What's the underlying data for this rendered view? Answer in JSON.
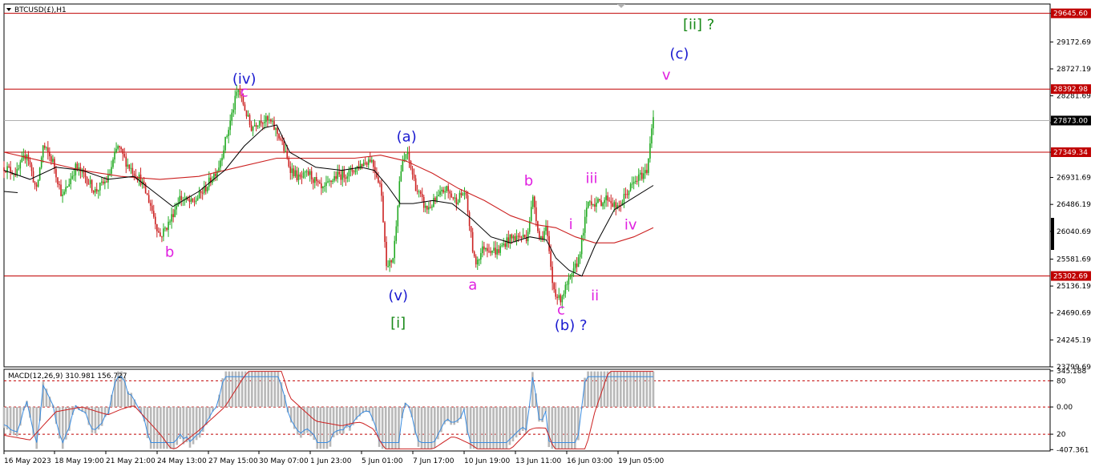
{
  "symbol_label": "BTCUSD(£),H1",
  "macd_label": "MACD(12,26,9) 310.981 156.727",
  "colors": {
    "bull": "#22aa22",
    "bear": "#cc2222",
    "ma_fast": "#000000",
    "ma_slow": "#cc2020",
    "level": "#c00000",
    "blue": "#1a1ad0",
    "magenta": "#e020e0",
    "green": "#1a8a1a",
    "macd_hist": "#b8b8b8",
    "macd_line": "#3a8ce0",
    "signal_line": "#cc2020"
  },
  "chart_data": {
    "type": "candlestick",
    "price_axis": {
      "min": 23799.69,
      "max": 29800,
      "ticks": [
        "29645.60",
        "29172.69",
        "28727.19",
        "28281.69",
        "27836.19",
        "27349.34",
        "26931.69",
        "26486.19",
        "26040.69",
        "25581.69",
        "25136.19",
        "24690.69",
        "24245.19",
        "23799.69"
      ]
    },
    "levels": [
      {
        "price": 29645.6,
        "label": "29645.60"
      },
      {
        "price": 28392.98,
        "label": "28392.98"
      },
      {
        "price": 27349.34,
        "label": "27349.34"
      },
      {
        "price": 25302.69,
        "label": "25302.69"
      }
    ],
    "current_price": {
      "price": 27873.0,
      "label": "27873.00"
    },
    "time_ticks": [
      "16 May 2023",
      "18 May 19:00",
      "21 May 21:00",
      "24 May 13:00",
      "27 May 15:00",
      "30 May 07:00",
      "1 Jun 23:00",
      "5 Jun 01:00",
      "7 Jun 17:00",
      "10 Jun 19:00",
      "13 Jun 11:00",
      "16 Jun 03:00",
      "19 Jun 05:00"
    ],
    "price_path": [
      [
        0,
        27100
      ],
      [
        0.02,
        27000
      ],
      [
        0.035,
        27350
      ],
      [
        0.05,
        26700
      ],
      [
        0.06,
        27450
      ],
      [
        0.075,
        27200
      ],
      [
        0.09,
        26600
      ],
      [
        0.11,
        27100
      ],
      [
        0.125,
        26950
      ],
      [
        0.14,
        26700
      ],
      [
        0.16,
        26900
      ],
      [
        0.175,
        27450
      ],
      [
        0.19,
        27150
      ],
      [
        0.21,
        26900
      ],
      [
        0.225,
        26500
      ],
      [
        0.24,
        25950
      ],
      [
        0.255,
        26200
      ],
      [
        0.27,
        26600
      ],
      [
        0.29,
        26500
      ],
      [
        0.31,
        26750
      ],
      [
        0.33,
        27100
      ],
      [
        0.345,
        27700
      ],
      [
        0.36,
        28400
      ],
      [
        0.37,
        28100
      ],
      [
        0.38,
        27750
      ],
      [
        0.395,
        27900
      ],
      [
        0.41,
        27850
      ],
      [
        0.425,
        27600
      ],
      [
        0.44,
        27100
      ],
      [
        0.455,
        26900
      ],
      [
        0.47,
        27000
      ],
      [
        0.49,
        26700
      ],
      [
        0.51,
        26950
      ],
      [
        0.53,
        27000
      ],
      [
        0.55,
        27150
      ],
      [
        0.565,
        27250
      ],
      [
        0.58,
        26800
      ],
      [
        0.59,
        25400
      ],
      [
        0.6,
        25650
      ],
      [
        0.61,
        27000
      ],
      [
        0.62,
        27350
      ],
      [
        0.635,
        26750
      ],
      [
        0.65,
        26400
      ],
      [
        0.665,
        26550
      ],
      [
        0.68,
        26750
      ],
      [
        0.695,
        26550
      ],
      [
        0.71,
        26700
      ],
      [
        0.725,
        25500
      ],
      [
        0.74,
        25800
      ],
      [
        0.76,
        25700
      ],
      [
        0.775,
        25900
      ],
      [
        0.79,
        25950
      ],
      [
        0.805,
        25950
      ],
      [
        0.815,
        26600
      ],
      [
        0.825,
        25900
      ],
      [
        0.835,
        26100
      ],
      [
        0.845,
        25150
      ],
      [
        0.855,
        24900
      ],
      [
        0.865,
        25100
      ],
      [
        0.875,
        25300
      ],
      [
        0.885,
        25600
      ],
      [
        0.9,
        26550
      ],
      [
        0.915,
        26500
      ],
      [
        0.93,
        26600
      ],
      [
        0.945,
        26400
      ],
      [
        0.96,
        26700
      ],
      [
        0.975,
        26900
      ],
      [
        0.99,
        27050
      ],
      [
        1,
        28000
      ]
    ],
    "ma_fast_path": [
      [
        0,
        27050
      ],
      [
        0.04,
        26900
      ],
      [
        0.08,
        27100
      ],
      [
        0.12,
        27050
      ],
      [
        0.16,
        26900
      ],
      [
        0.2,
        26950
      ],
      [
        0.23,
        26700
      ],
      [
        0.26,
        26450
      ],
      [
        0.3,
        26700
      ],
      [
        0.34,
        27050
      ],
      [
        0.37,
        27450
      ],
      [
        0.4,
        27750
      ],
      [
        0.42,
        27800
      ],
      [
        0.44,
        27350
      ],
      [
        0.48,
        27100
      ],
      [
        0.52,
        27050
      ],
      [
        0.55,
        27100
      ],
      [
        0.57,
        27050
      ],
      [
        0.59,
        26800
      ],
      [
        0.61,
        26500
      ],
      [
        0.63,
        26500
      ],
      [
        0.66,
        26550
      ],
      [
        0.69,
        26500
      ],
      [
        0.72,
        26250
      ],
      [
        0.75,
        25950
      ],
      [
        0.78,
        25850
      ],
      [
        0.81,
        25950
      ],
      [
        0.835,
        25900
      ],
      [
        0.85,
        25600
      ],
      [
        0.87,
        25400
      ],
      [
        0.89,
        25300
      ],
      [
        0.91,
        25800
      ],
      [
        0.94,
        26400
      ],
      [
        0.97,
        26600
      ],
      [
        1,
        26800
      ]
    ],
    "ma_slow_path": [
      [
        0,
        27350
      ],
      [
        0.06,
        27200
      ],
      [
        0.12,
        27050
      ],
      [
        0.18,
        26950
      ],
      [
        0.24,
        26900
      ],
      [
        0.3,
        26950
      ],
      [
        0.36,
        27100
      ],
      [
        0.42,
        27250
      ],
      [
        0.48,
        27250
      ],
      [
        0.54,
        27250
      ],
      [
        0.58,
        27300
      ],
      [
        0.62,
        27200
      ],
      [
        0.66,
        27000
      ],
      [
        0.7,
        26750
      ],
      [
        0.74,
        26550
      ],
      [
        0.78,
        26300
      ],
      [
        0.82,
        26150
      ],
      [
        0.85,
        26100
      ],
      [
        0.88,
        25950
      ],
      [
        0.91,
        25850
      ],
      [
        0.94,
        25850
      ],
      [
        0.97,
        25950
      ],
      [
        1,
        26100
      ]
    ],
    "macd": {
      "axis_ticks": [
        "345.188",
        "80",
        "0.00",
        "20",
        "-407.361"
      ],
      "levels": [
        80,
        0,
        -20
      ]
    },
    "annotations": [
      {
        "text": "(iv)",
        "x": 0.37,
        "price": 28480,
        "color": "blue"
      },
      {
        "text": "c",
        "x": 0.37,
        "price": 28270,
        "color": "magenta"
      },
      {
        "text": "b",
        "x": 0.255,
        "price": 25620,
        "color": "magenta"
      },
      {
        "text": "(a)",
        "x": 0.62,
        "price": 27530,
        "color": "blue"
      },
      {
        "text": "(v)",
        "x": 0.607,
        "price": 24900,
        "color": "blue"
      },
      {
        "text": "[i]",
        "x": 0.607,
        "price": 24450,
        "color": "green"
      },
      {
        "text": "b",
        "x": 0.808,
        "price": 26800,
        "color": "magenta"
      },
      {
        "text": "a",
        "x": 0.722,
        "price": 25080,
        "color": "magenta"
      },
      {
        "text": "c",
        "x": 0.858,
        "price": 24670,
        "color": "magenta"
      },
      {
        "text": "(b) ?",
        "x": 0.873,
        "price": 24410,
        "color": "blue"
      },
      {
        "text": "i",
        "x": 0.873,
        "price": 26080,
        "color": "magenta"
      },
      {
        "text": "ii",
        "x": 0.91,
        "price": 24900,
        "color": "magenta"
      },
      {
        "text": "iii",
        "x": 0.905,
        "price": 26840,
        "color": "magenta"
      },
      {
        "text": "iv",
        "x": 0.965,
        "price": 26070,
        "color": "magenta"
      },
      {
        "text": "v",
        "x": 1.02,
        "price": 28550,
        "color": "magenta"
      },
      {
        "text": "(c)",
        "x": 1.04,
        "price": 28900,
        "color": "blue"
      },
      {
        "text": "[ii] ?",
        "x": 1.07,
        "price": 29380,
        "color": "green"
      }
    ]
  }
}
